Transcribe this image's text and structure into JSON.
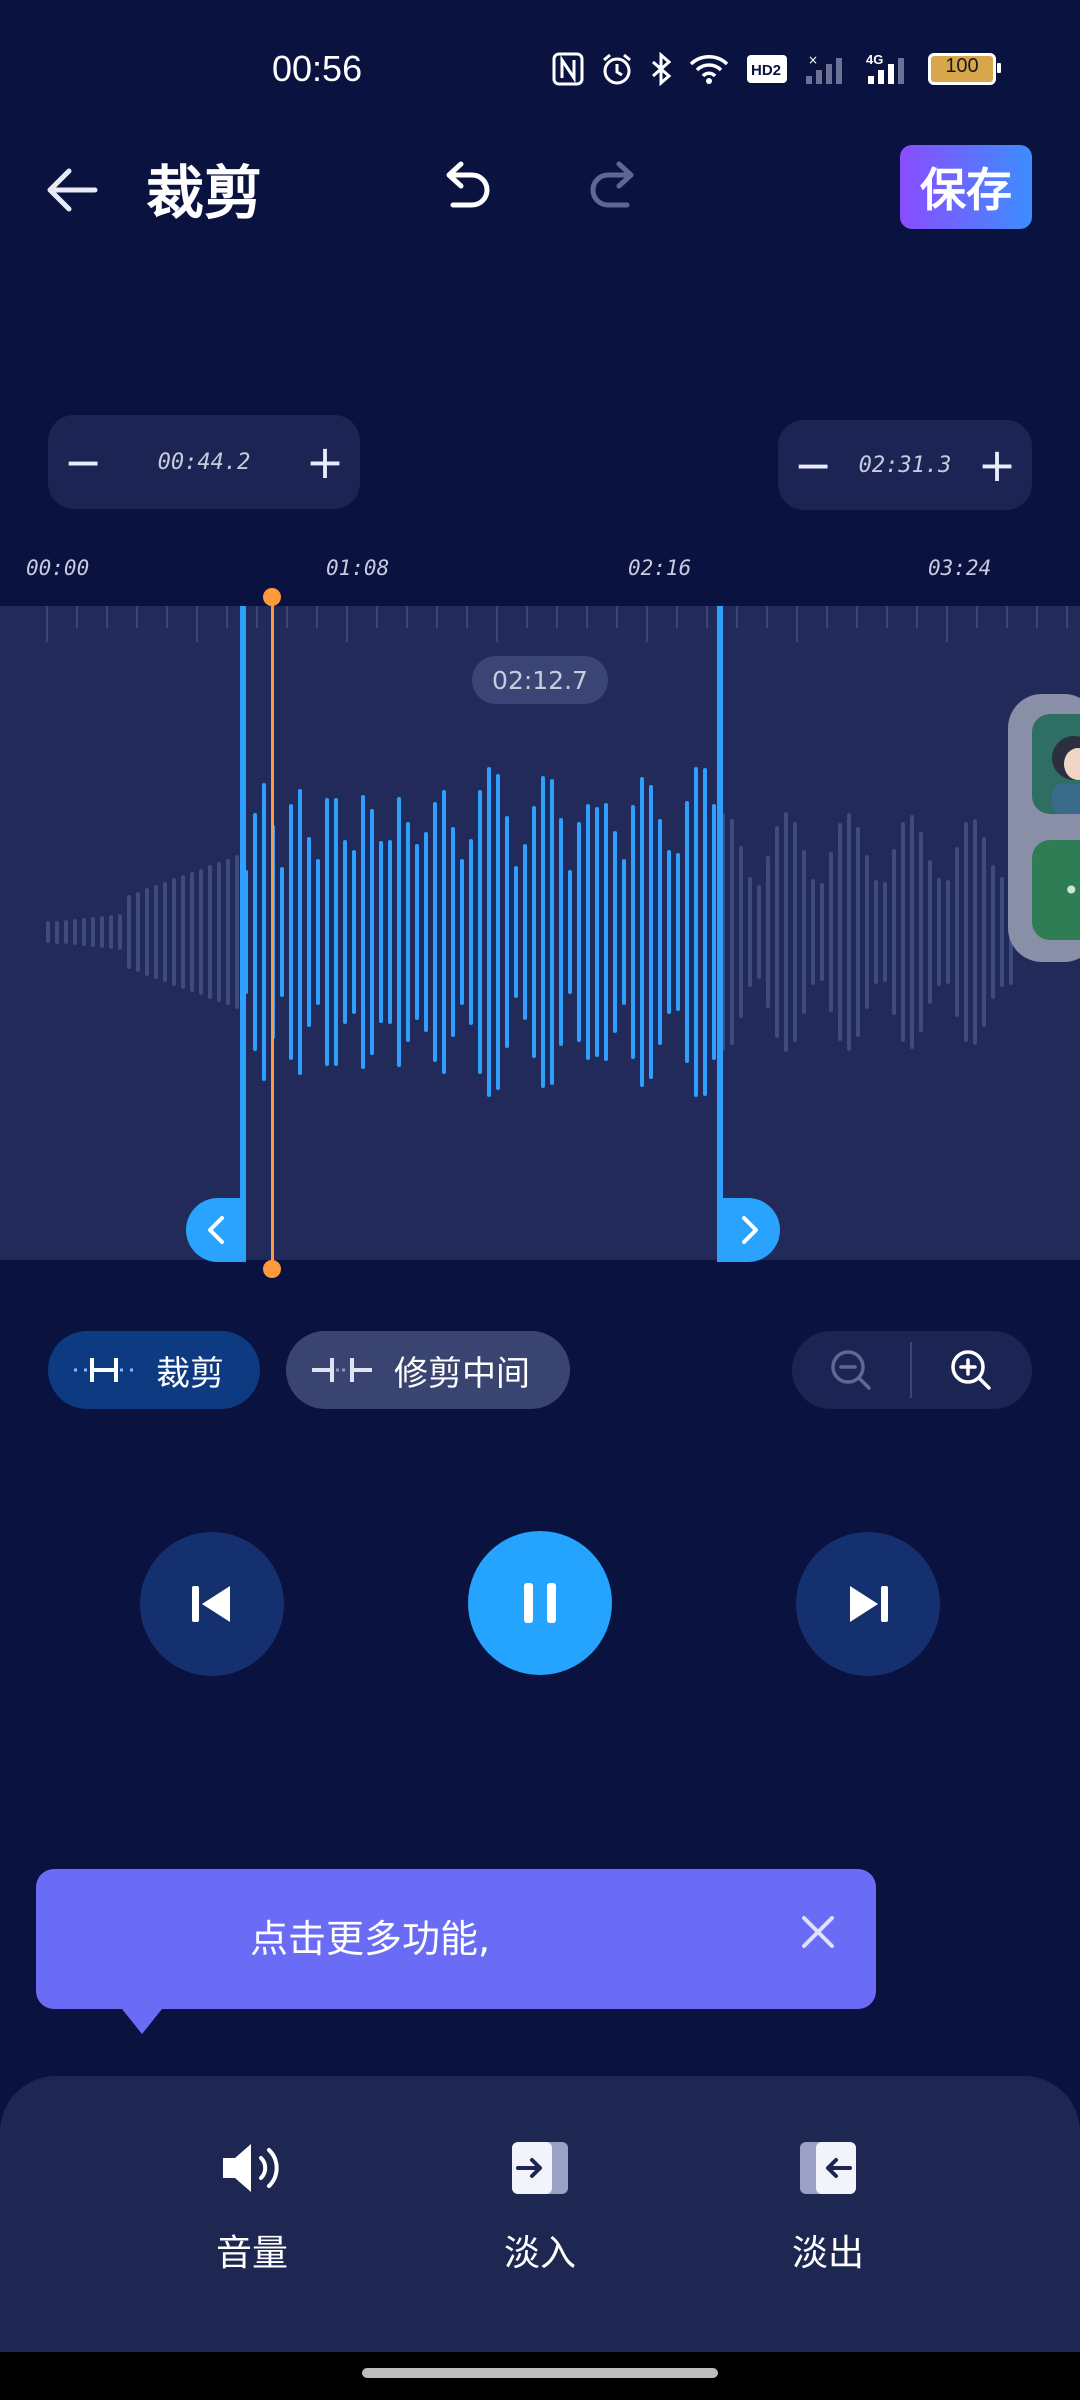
{
  "status_bar": {
    "time": "00:56",
    "battery": "100",
    "network": "4G",
    "icons": [
      "nfc-icon",
      "alarm-icon",
      "bluetooth-icon",
      "wifi-icon",
      "hd-icon",
      "signal-icon",
      "battery-icon"
    ]
  },
  "header": {
    "title": "裁剪",
    "save_label": "保存",
    "back_icon": "arrow-left-icon",
    "undo_icon": "undo-icon",
    "redo_icon": "redo-icon",
    "accent_gradient": [
      "#8a4dff",
      "#3d8dff"
    ]
  },
  "trim": {
    "start_time": "00:44.2",
    "end_time": "02:31.3",
    "current_time": "02:12.7",
    "minus": "−",
    "plus": "+"
  },
  "ruler": {
    "labels": [
      "00:00",
      "01:08",
      "02:16",
      "03:24"
    ]
  },
  "modes": {
    "crop_label": "裁剪",
    "trim_middle_label": "修剪中间"
  },
  "tooltip": {
    "text": "点击更多功能,"
  },
  "tools": [
    {
      "label": "音量",
      "icon": "volume-icon"
    },
    {
      "label": "淡入",
      "icon": "fade-in-icon"
    },
    {
      "label": "淡出",
      "icon": "fade-out-icon"
    }
  ],
  "colors": {
    "background": "#0a1240",
    "wave_selected": "#2f9fff",
    "wave_unselected": "#3f4a7e",
    "playhead": "#ff9a3c",
    "tooltip": "#6a6cf5"
  }
}
